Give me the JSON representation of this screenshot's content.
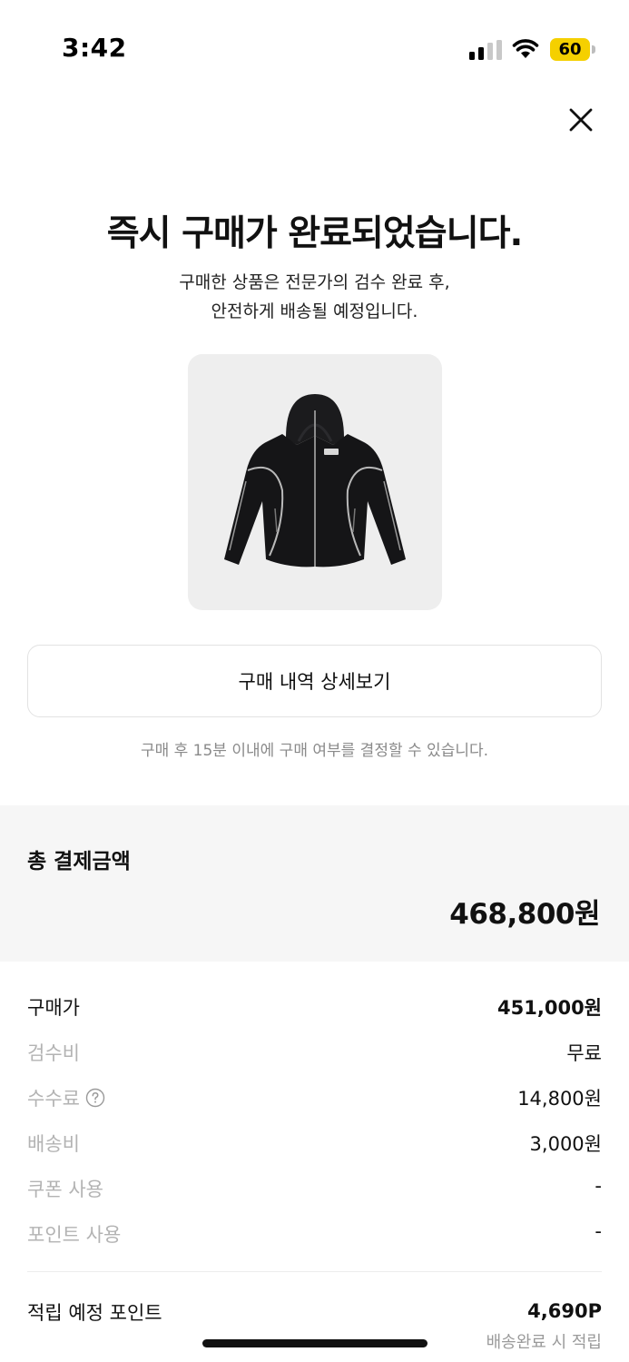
{
  "status_bar": {
    "time": "3:42",
    "battery": "60",
    "battery_color": "#f5d000"
  },
  "header": {
    "close_icon": "close-icon"
  },
  "title": "즉시 구매가 완료되었습니다.",
  "subtitle": {
    "line1": "구매한 상품은 전문가의 검수 완료 후,",
    "line2": "안전하게 배송될 예정입니다."
  },
  "product": {
    "image": "black-hooded-jacket"
  },
  "detail_button": {
    "label": "구매 내역 상세보기"
  },
  "notice": "구매 후 15분 이내에 구매 여부를 결정할 수 있습니다.",
  "total": {
    "label": "총 결제금액",
    "amount": "468,800원"
  },
  "breakdown": [
    {
      "label": "구매가",
      "value": "451,000원"
    },
    {
      "label": "검수비",
      "value": "무료"
    },
    {
      "label": "수수료",
      "value": "14,800원",
      "help_icon": "question-circle-icon"
    },
    {
      "label": "배송비",
      "value": "3,000원"
    },
    {
      "label": "쿠폰 사용",
      "value": "-"
    },
    {
      "label": "포인트 사용",
      "value": "-"
    }
  ],
  "points": {
    "label": "적립 예정 포인트",
    "value": "4,690P",
    "note": "배송완료 시 적립"
  }
}
